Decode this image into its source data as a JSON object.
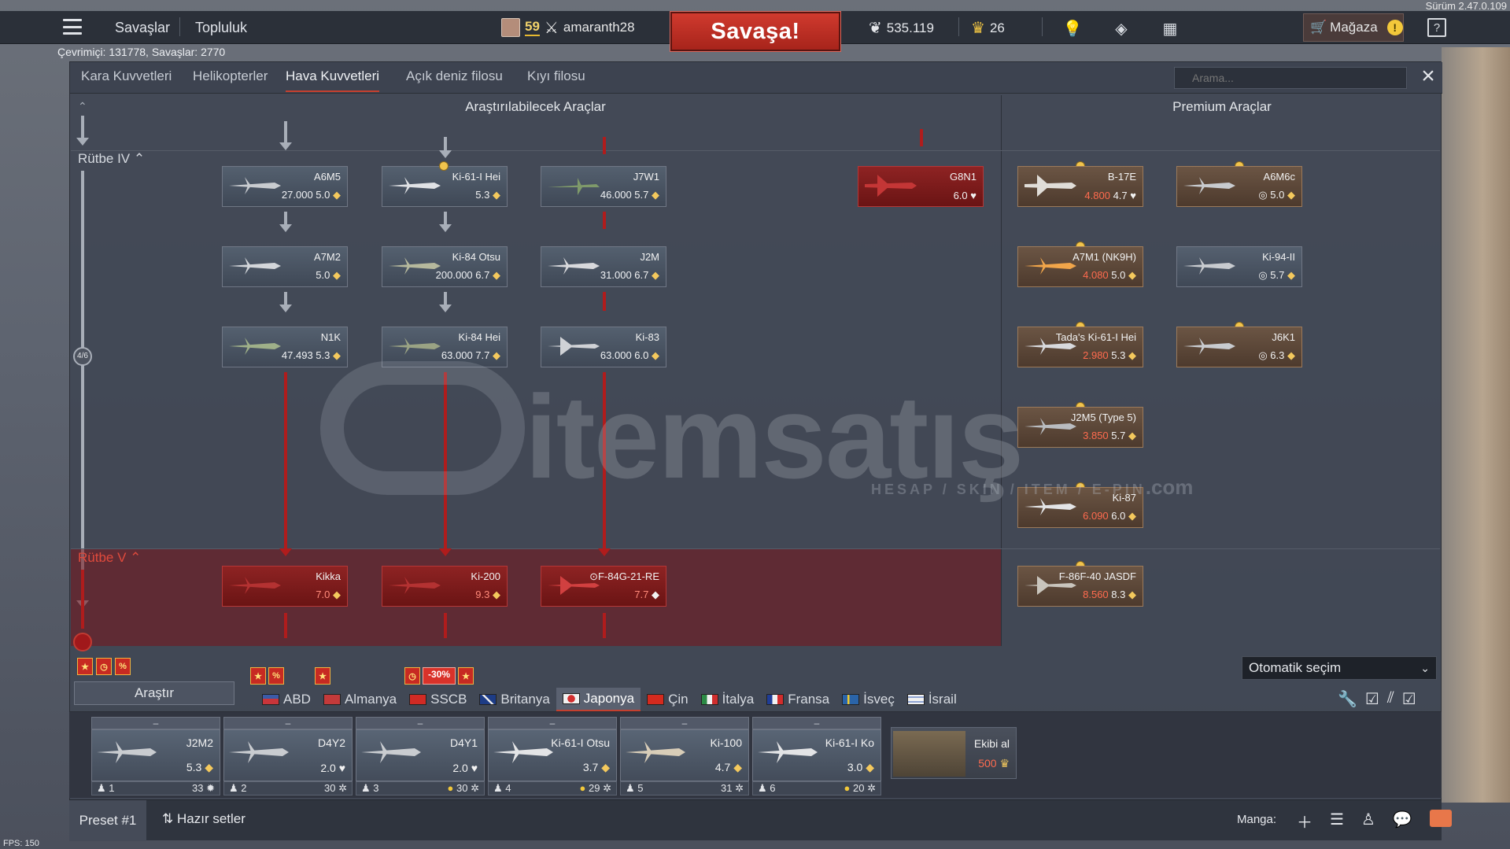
{
  "app": {
    "version": "Sürüm 2.47.0.109",
    "online_text": "Çevrimiçi: 131778, Savaşlar: 2770",
    "fps": "FPS: 150"
  },
  "topbar": {
    "nav": [
      "Savaşlar",
      "Topluluk"
    ],
    "player_level": "59",
    "player_name": "amaranth28",
    "battle_label": "Savaşa!",
    "silver_lions": "535.119",
    "golden_eagles": "26",
    "shop_label": "Mağaza",
    "shop_warn": "!",
    "help": "?"
  },
  "tabs": {
    "items": [
      "Kara Kuvvetleri",
      "Helikopterler",
      "Hava Kuvvetleri",
      "Açık deniz filosu",
      "Kıyı filosu"
    ],
    "active": "Hava Kuvvetleri",
    "search_placeholder": "Arama..."
  },
  "sections": {
    "research": "Araştırılabilecek Araçlar",
    "premium": "Premium Araçlar"
  },
  "ranks": {
    "rank4": "Rütbe IV",
    "rank5": "Rütbe V",
    "progress": "4/6"
  },
  "tree": {
    "rank4": [
      {
        "name": "A6M5",
        "cost": "27.000",
        "br": "5.0",
        "type": "research"
      },
      {
        "name": "Ki-61-I Hei",
        "cost": "",
        "br": "5.3",
        "type": "research"
      },
      {
        "name": "J7W1",
        "cost": "46.000",
        "br": "5.7",
        "type": "research"
      },
      {
        "name": "G8N1",
        "cost": "",
        "br": "6.0",
        "type": "locked"
      },
      {
        "name": "A7M2",
        "cost": "",
        "br": "5.0",
        "type": "research"
      },
      {
        "name": "Ki-84 Otsu",
        "cost": "200.000",
        "br": "6.7",
        "type": "research"
      },
      {
        "name": "J2M",
        "cost": "31.000",
        "br": "6.7",
        "type": "research"
      },
      {
        "name": "N1K",
        "cost": "47.493",
        "br": "5.3",
        "type": "research"
      },
      {
        "name": "Ki-84 Hei",
        "cost": "63.000",
        "br": "7.7",
        "type": "research"
      },
      {
        "name": "Ki-83",
        "cost": "63.000",
        "br": "6.0",
        "type": "research"
      }
    ],
    "rank5": [
      {
        "name": "Kikka",
        "br": "7.0"
      },
      {
        "name": "Ki-200",
        "br": "9.3"
      },
      {
        "name": "F-84G-21-RE",
        "br": "7.7"
      }
    ],
    "premium": [
      {
        "name": "B-17E",
        "cost": "4.800",
        "br": "4.7"
      },
      {
        "name": "A6M6c",
        "cost": "",
        "br": "5.0"
      },
      {
        "name": "A7M1 (NK9H)",
        "cost": "4.080",
        "br": "5.0"
      },
      {
        "name": "Ki-94-II",
        "cost": "",
        "br": "5.7"
      },
      {
        "name": "Tada's Ki-61-I Hei",
        "cost": "2.980",
        "br": "5.3"
      },
      {
        "name": "J6K1",
        "cost": "",
        "br": "6.3"
      },
      {
        "name": "J2M5 (Type 5)",
        "cost": "3.850",
        "br": "5.7"
      },
      {
        "name": "Ki-87",
        "cost": "6.090",
        "br": "6.0"
      },
      {
        "name": "F-86F-40 JASDF",
        "cost": "8.560",
        "br": "8.3"
      }
    ]
  },
  "bottom": {
    "research_btn": "Araştır",
    "auto_select": "Otomatik seçim",
    "discount": "-30%",
    "nations": [
      "ABD",
      "Almanya",
      "SSCB",
      "Britanya",
      "Japonya",
      "Çin",
      "İtalya",
      "Fransa",
      "İsveç",
      "İsrail"
    ],
    "active_nation": "Japonya",
    "crew_slots": [
      {
        "dash": "–",
        "name": "J2M2",
        "br": "5.3",
        "crew": "1",
        "level": "33"
      },
      {
        "dash": "–",
        "name": "D4Y2",
        "br": "2.0",
        "crew": "2",
        "level": "30"
      },
      {
        "dash": "–",
        "name": "D4Y1",
        "br": "2.0",
        "crew": "3",
        "level": "30"
      },
      {
        "dash": "–",
        "name": "Ki-61-I Otsu",
        "br": "3.7",
        "crew": "4",
        "level": "29"
      },
      {
        "dash": "–",
        "name": "Ki-100",
        "br": "4.7",
        "crew": "5",
        "level": "31"
      },
      {
        "dash": "–",
        "name": "Ki-61-I Ko",
        "br": "3.0",
        "crew": "6",
        "level": "20"
      }
    ],
    "crew_get_label": "Ekibi al",
    "crew_get_price": "500"
  },
  "footer": {
    "preset": "Preset #1",
    "ready_sets": "Hazır setler",
    "manga": "Manga:"
  },
  "watermark": {
    "brand": "itemsatış",
    "sub": "HESAP / SKIN / ITEM / E-PIN",
    "dotcom": ".com"
  },
  "colors": {
    "accent_red": "#c5402f",
    "battle_red": "#d03a2e",
    "locked_red": "#8e2323",
    "premium_brown": "#6b5544",
    "gold": "#f4c95d"
  },
  "icons": [
    "menu-icon",
    "swords-icon",
    "eagle-icon",
    "lion-icon",
    "lightbulb-icon",
    "diamond-icon",
    "ticket-icon",
    "cart-icon",
    "search-icon",
    "close-icon",
    "wrench-icon",
    "check-icon",
    "plus-icon",
    "list-icon",
    "squad-icon",
    "chat-icon",
    "mail-icon"
  ]
}
